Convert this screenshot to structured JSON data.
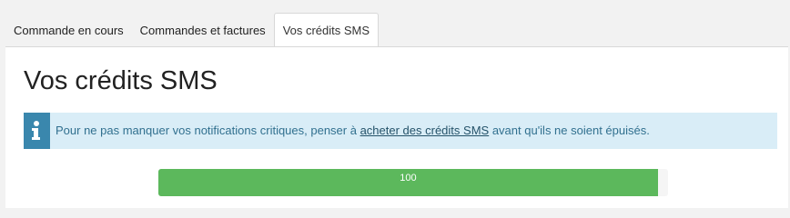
{
  "tabs": [
    {
      "label": "Commande en cours",
      "active": false
    },
    {
      "label": "Commandes et factures",
      "active": false
    },
    {
      "label": "Vos crédits SMS",
      "active": true
    }
  ],
  "page_title": "Vos crédits SMS",
  "alert": {
    "icon": "info-icon",
    "text_before": "Pour ne pas manquer vos notifications critiques, penser à ",
    "link_text": "acheter des crédits SMS",
    "text_after": " avant qu'ils ne soient épuisés."
  },
  "progress": {
    "label": "100",
    "fill_fraction": 0.98
  },
  "colors": {
    "alert_background": "#d9edf7",
    "alert_icon_bg": "#3a87ad",
    "progress_fill": "#5cb85c"
  }
}
